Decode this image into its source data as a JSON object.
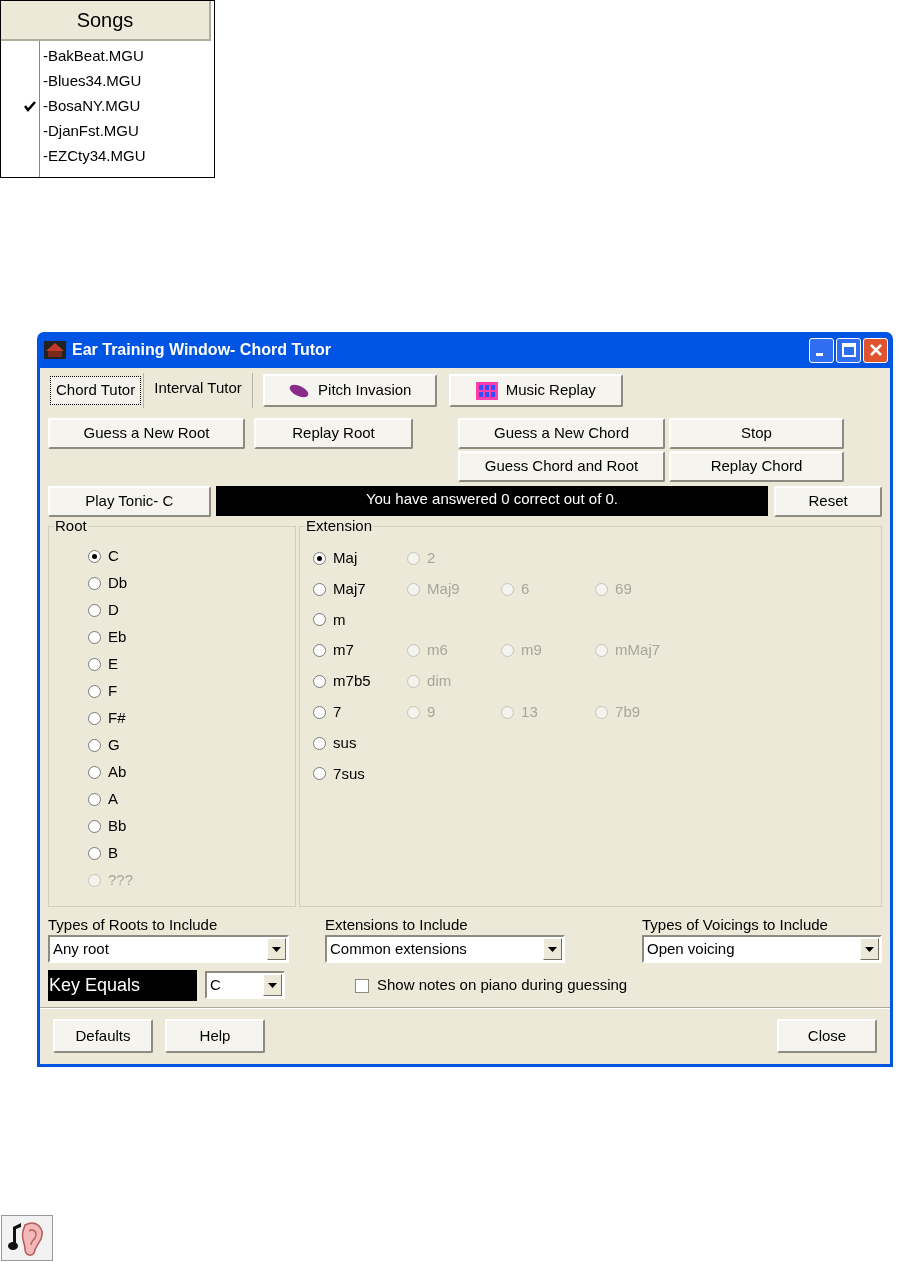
{
  "songs_menu": {
    "header": "Songs",
    "items": [
      {
        "label": "-BakBeat.MGU",
        "checked": false
      },
      {
        "label": "-Blues34.MGU",
        "checked": false
      },
      {
        "label": "-BosaNY.MGU",
        "checked": true
      },
      {
        "label": "-DjanFst.MGU",
        "checked": false
      },
      {
        "label": "-EZCty34.MGU",
        "checked": false
      }
    ]
  },
  "window": {
    "title": "Ear Training Window- Chord Tutor"
  },
  "tabs": [
    {
      "label": "Chord Tutor",
      "selected": true
    },
    {
      "label": "Interval Tutor",
      "selected": false
    }
  ],
  "tool_buttons": [
    {
      "label": "Pitch Invasion",
      "kind": "pitch"
    },
    {
      "label": "Music Replay",
      "kind": "replay"
    }
  ],
  "buttons_left": [
    "Guess a New Root",
    "Replay Root"
  ],
  "buttons_right": [
    [
      "Guess a New Chord",
      "Stop"
    ],
    [
      "Guess Chord and Root",
      "Replay Chord"
    ]
  ],
  "play_tonic": "Play Tonic- C",
  "score_text": "You have answered 0 correct out of 0.",
  "reset": "Reset",
  "root": {
    "title": "Root",
    "items": [
      {
        "label": "C",
        "selected": true,
        "disabled": false
      },
      {
        "label": "Db",
        "selected": false,
        "disabled": false
      },
      {
        "label": "D",
        "selected": false,
        "disabled": false
      },
      {
        "label": "Eb",
        "selected": false,
        "disabled": false
      },
      {
        "label": "E",
        "selected": false,
        "disabled": false
      },
      {
        "label": "F",
        "selected": false,
        "disabled": false
      },
      {
        "label": "F#",
        "selected": false,
        "disabled": false
      },
      {
        "label": "G",
        "selected": false,
        "disabled": false
      },
      {
        "label": "Ab",
        "selected": false,
        "disabled": false
      },
      {
        "label": "A",
        "selected": false,
        "disabled": false
      },
      {
        "label": "Bb",
        "selected": false,
        "disabled": false
      },
      {
        "label": "B",
        "selected": false,
        "disabled": false
      },
      {
        "label": "???",
        "selected": false,
        "disabled": true
      }
    ]
  },
  "extension": {
    "title": "Extension",
    "rows": [
      [
        {
          "label": "Maj",
          "selected": true,
          "disabled": false
        },
        {
          "label": "2",
          "selected": false,
          "disabled": true
        }
      ],
      [
        {
          "label": "Maj7",
          "selected": false,
          "disabled": false
        },
        {
          "label": "Maj9",
          "selected": false,
          "disabled": true
        },
        {
          "label": "6",
          "selected": false,
          "disabled": true
        },
        {
          "label": "69",
          "selected": false,
          "disabled": true
        }
      ],
      [
        {
          "label": "m",
          "selected": false,
          "disabled": false
        }
      ],
      [
        {
          "label": "m7",
          "selected": false,
          "disabled": false
        },
        {
          "label": "m6",
          "selected": false,
          "disabled": true
        },
        {
          "label": "m9",
          "selected": false,
          "disabled": true
        },
        {
          "label": "mMaj7",
          "selected": false,
          "disabled": true
        }
      ],
      [
        {
          "label": "m7b5",
          "selected": false,
          "disabled": false
        },
        {
          "label": "dim",
          "selected": false,
          "disabled": true
        }
      ],
      [
        {
          "label": "7",
          "selected": false,
          "disabled": false
        },
        {
          "label": "9",
          "selected": false,
          "disabled": true
        },
        {
          "label": "13",
          "selected": false,
          "disabled": true
        },
        {
          "label": "7b9",
          "selected": false,
          "disabled": true
        }
      ],
      [
        {
          "label": "sus",
          "selected": false,
          "disabled": false
        }
      ],
      [
        {
          "label": "7sus",
          "selected": false,
          "disabled": false
        }
      ]
    ]
  },
  "dropdowns": [
    {
      "label": "Types of Roots to Include",
      "value": "Any root"
    },
    {
      "label": "Extensions to Include",
      "value": "Common extensions"
    },
    {
      "label": "Types of Voicings to Include",
      "value": "Open voicing"
    }
  ],
  "key": {
    "label": "Key Equals",
    "value": "C"
  },
  "show_notes": {
    "label": "Show notes on piano during guessing",
    "checked": false
  },
  "footer_buttons": {
    "left": [
      "Defaults",
      "Help"
    ],
    "right": [
      "Close"
    ]
  }
}
